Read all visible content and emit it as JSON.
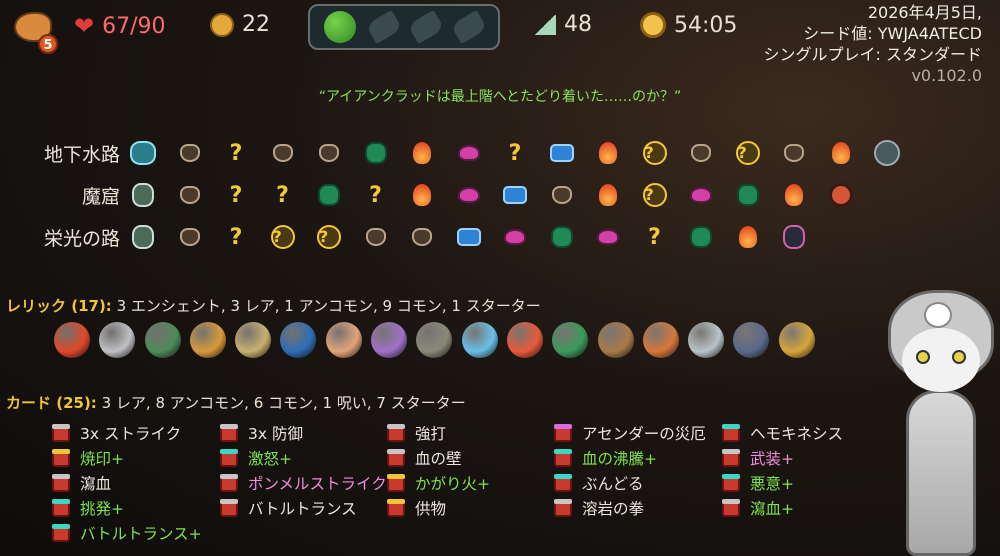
{
  "topbar": {
    "character_icon": "ironclad-icon",
    "ascension_level": "5",
    "hp": "67/90",
    "gold": "22",
    "potion_slots": [
      "clover-potion",
      "empty",
      "empty",
      "empty"
    ],
    "floor": "48",
    "time": "54:05"
  },
  "run_info": {
    "date": "2026年4月5日,",
    "seed": "シード値: YWJA4ATECD",
    "mode": "シングルプレイ: スタンダード",
    "version": "v0.102.0"
  },
  "quote": "“アイアンクラッドは最上階へとたどり着いた……のか？”",
  "acts": [
    {
      "name": "地下水路",
      "nodes": [
        "ancient",
        "monster",
        "unknown",
        "monster",
        "monster",
        "merchant",
        "rest",
        "evil",
        "unknown",
        "chest",
        "rest",
        "elite",
        "monster",
        "elite",
        "monster",
        "rest",
        "boss2"
      ]
    },
    {
      "name": "魔窟",
      "nodes": [
        "ancient2",
        "monster",
        "unknown",
        "unknown",
        "merchant",
        "unknown",
        "rest",
        "evil",
        "chest",
        "monster",
        "rest",
        "elite",
        "evil",
        "merchant",
        "rest",
        "boss3"
      ]
    },
    {
      "name": "栄光の路",
      "nodes": [
        "ancient3",
        "monster",
        "unknown",
        "elite",
        "elite",
        "monster",
        "monster",
        "chest",
        "evil",
        "merchant",
        "evil",
        "unknown",
        "merchant",
        "rest",
        "boss4"
      ]
    }
  ],
  "relics": {
    "heading": "レリック (17):",
    "summary": "3 エンシェント, 3 レア, 1 アンコモン, 9 コモン, 1 スターター",
    "colors": [
      "#e0482a",
      "#bfc0c4",
      "#4f8a5a",
      "#d99a3a",
      "#c8b070",
      "#2e6db5",
      "#e3a47a",
      "#a070c8",
      "#8a8a7a",
      "#6ac0e8",
      "#e85a3a",
      "#3a9a5a",
      "#a87a4a",
      "#d6783a",
      "#b8c4c8",
      "#5a6a8a",
      "#d6a63a"
    ]
  },
  "cards": {
    "heading": "カード (25):",
    "summary": "3 レア, 8 アンコモン, 6 コモン, 1 呪い, 7 スターター",
    "items": [
      {
        "name": "3x ストライク",
        "color": "white",
        "rarity": "#c6c6c6"
      },
      {
        "name": "3x 防御",
        "color": "white",
        "rarity": "#c6c6c6"
      },
      {
        "name": "強打",
        "color": "white",
        "rarity": "#c6c6c6"
      },
      {
        "name": "アセンダーの災厄",
        "color": "white",
        "rarity": "#d66ae0"
      },
      {
        "name": "ヘモキネシス",
        "color": "white",
        "rarity": "#3ad6c6"
      },
      {
        "name": "焼印+",
        "color": "green",
        "rarity": "#f0c53a"
      },
      {
        "name": "激怒+",
        "color": "green",
        "rarity": "#3ad6c6"
      },
      {
        "name": "血の壁",
        "color": "white",
        "rarity": "#c6c6c6"
      },
      {
        "name": "血の沸騰+",
        "color": "green",
        "rarity": "#3ad6c6"
      },
      {
        "name": "武装+",
        "color": "pink",
        "rarity": "#c6c6c6"
      },
      {
        "name": "瀉血",
        "color": "white",
        "rarity": "#c6c6c6"
      },
      {
        "name": "ポンメルストライク+",
        "color": "pink",
        "rarity": "#c6c6c6"
      },
      {
        "name": "かがり火+",
        "color": "green",
        "rarity": "#f0c53a"
      },
      {
        "name": "ぶんどる",
        "color": "white",
        "rarity": "#3ad6c6"
      },
      {
        "name": "悪意+",
        "color": "green",
        "rarity": "#3ad6c6"
      },
      {
        "name": "挑発+",
        "color": "green",
        "rarity": "#3ad6c6"
      },
      {
        "name": "バトルトランス",
        "color": "white",
        "rarity": "#c6c6c6"
      },
      {
        "name": "供物",
        "color": "white",
        "rarity": "#f0c53a"
      },
      {
        "name": "溶岩の拳",
        "color": "white",
        "rarity": "#c6c6c6"
      },
      {
        "name": "瀉血+",
        "color": "green",
        "rarity": "#c6c6c6"
      },
      {
        "name": "バトルトランス+",
        "color": "green",
        "rarity": "#3ad6c6"
      }
    ]
  }
}
